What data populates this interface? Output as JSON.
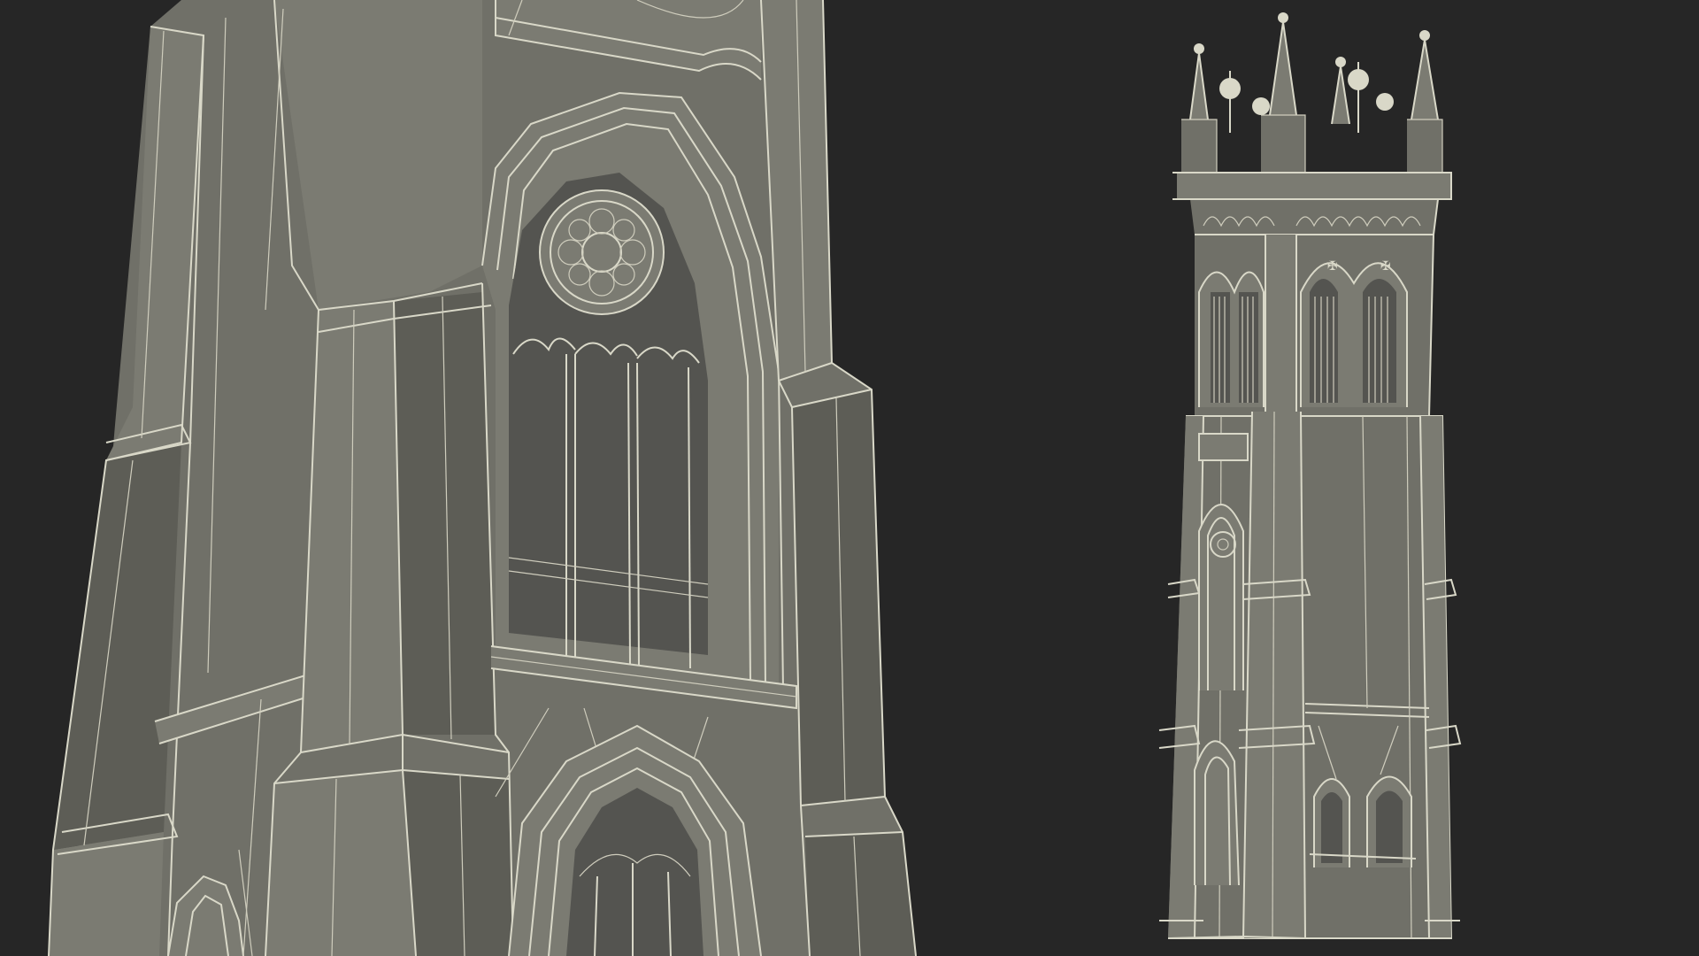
{
  "scene": {
    "background_color": "#262626",
    "stone_color": "#707068",
    "wireframe_color": "#d9d8c8",
    "views": [
      "closeup-view",
      "full-tower-view"
    ]
  }
}
